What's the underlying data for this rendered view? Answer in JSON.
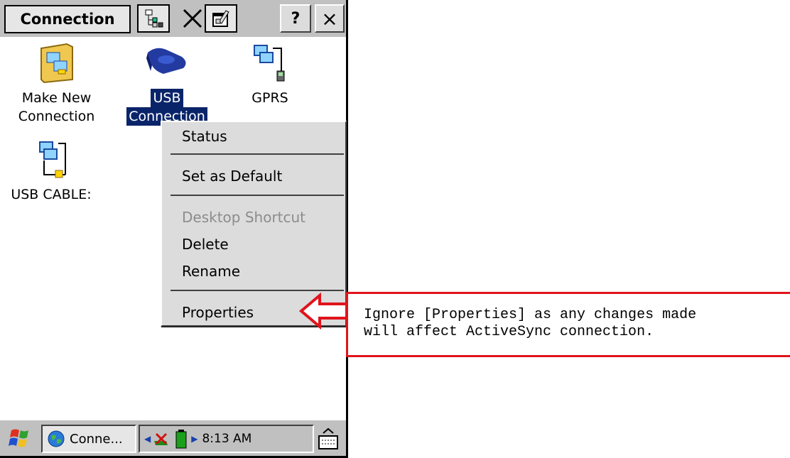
{
  "window": {
    "title": "Connection",
    "help_label": "?",
    "close_label": "×",
    "delete_label": "✕"
  },
  "icons": [
    {
      "label_line1": "Make New",
      "label_line2": "Connection"
    },
    {
      "label_line1": "USB",
      "label_line2": "Connection"
    },
    {
      "label_line1": "GPRS",
      "label_line2": ""
    },
    {
      "label_line1": "USB CABLE:",
      "label_line2": ""
    }
  ],
  "context_menu": {
    "items": [
      {
        "label": "Status",
        "enabled": true
      },
      {
        "label": "Set as Default",
        "enabled": true
      },
      {
        "label": "Desktop Shortcut",
        "enabled": false
      },
      {
        "label": "Delete",
        "enabled": true
      },
      {
        "label": "Rename",
        "enabled": true
      },
      {
        "label": "Properties",
        "enabled": true
      }
    ]
  },
  "taskbar": {
    "task_label": "Conne...",
    "time": "8:13 AM"
  },
  "callout": {
    "line1": "Ignore [Properties] as any changes made",
    "line2": "will affect ActiveSync connection."
  },
  "colors": {
    "selection": "#0a246a",
    "callout_border": "#e0141c",
    "arrow": "#e0141c",
    "chrome": "#c0c0c0"
  }
}
